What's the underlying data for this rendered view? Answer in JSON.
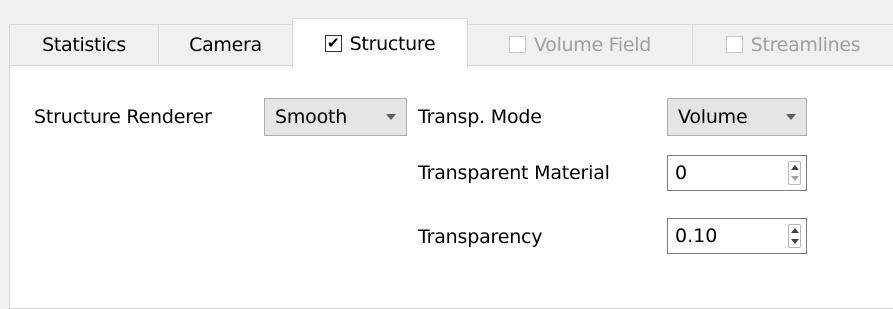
{
  "tabs": [
    {
      "label": "Statistics",
      "checkbox": false,
      "active": false,
      "disabled": false
    },
    {
      "label": "Camera",
      "checkbox": false,
      "active": false,
      "disabled": false
    },
    {
      "label": "Structure",
      "checkbox": true,
      "checked": true,
      "active": true,
      "disabled": false
    },
    {
      "label": "Volume Field",
      "checkbox": true,
      "checked": false,
      "active": false,
      "disabled": true
    },
    {
      "label": "Streamlines",
      "checkbox": true,
      "checked": false,
      "active": false,
      "disabled": true
    }
  ],
  "checkmark_glyph": "✔",
  "structure": {
    "renderer_label": "Structure Renderer",
    "renderer_value": "Smooth",
    "transp_mode_label": "Transp. Mode",
    "transp_mode_value": "Volume",
    "transparent_material_label": "Transparent Material",
    "transparent_material_value": "0",
    "transparency_label": "Transparency",
    "transparency_value": "0.10"
  }
}
